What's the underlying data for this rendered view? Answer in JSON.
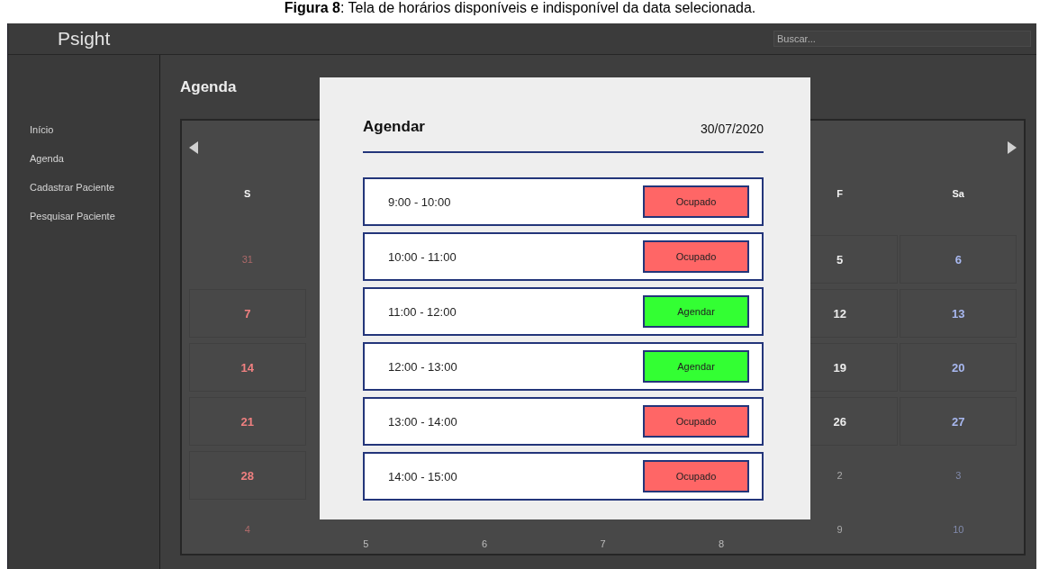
{
  "caption": "**Figura 8**: Tela de horários disponíveis e indisponível da data selecionada.",
  "header": {
    "logo": "Psight",
    "search": {
      "placeholder": "Buscar..."
    }
  },
  "sidebar": {
    "items": [
      {
        "label": "Início"
      },
      {
        "label": "Agenda"
      },
      {
        "label": "Cadastrar Paciente"
      },
      {
        "label": "Pesquisar Paciente"
      }
    ]
  },
  "page_title": "Agenda",
  "calendar": {
    "columns": [
      {
        "kind": "full",
        "weekday": "S",
        "color": "#f08080",
        "days": [
          {
            "day": "31",
            "in_month": false
          },
          {
            "day": "7",
            "in_month": true
          },
          {
            "day": "14",
            "in_month": true
          },
          {
            "day": "21",
            "in_month": true
          },
          {
            "day": "28",
            "in_month": true
          },
          {
            "day": "4",
            "in_month": false
          }
        ]
      },
      {
        "kind": "covered",
        "days": [
          {
            "day": "5"
          }
        ]
      },
      {
        "kind": "covered",
        "days": [
          {
            "day": "6"
          }
        ]
      },
      {
        "kind": "covered",
        "days": [
          {
            "day": "7"
          }
        ]
      },
      {
        "kind": "covered",
        "days": [
          {
            "day": "8"
          }
        ]
      },
      {
        "kind": "full",
        "weekday": "F",
        "color": "#ececec",
        "days": [
          {
            "day": "5",
            "in_month": true
          },
          {
            "day": "12",
            "in_month": true
          },
          {
            "day": "19",
            "in_month": true
          },
          {
            "day": "26",
            "in_month": true
          },
          {
            "day": "2",
            "in_month": false
          },
          {
            "day": "9",
            "in_month": false
          }
        ]
      },
      {
        "kind": "full",
        "weekday": "Sa",
        "color": "#a8b8f0",
        "days": [
          {
            "day": "6",
            "in_month": true
          },
          {
            "day": "13",
            "in_month": true
          },
          {
            "day": "20",
            "in_month": true
          },
          {
            "day": "27",
            "in_month": true
          },
          {
            "day": "3",
            "in_month": false
          },
          {
            "day": "10",
            "in_month": false
          }
        ]
      }
    ]
  },
  "modal": {
    "title": "Agendar",
    "date": "30/07/2020",
    "slots": [
      {
        "time": "9:00 - 10:00",
        "kind": "busy",
        "action": "Ocupado"
      },
      {
        "time": "10:00 - 11:00",
        "kind": "busy",
        "action": "Ocupado"
      },
      {
        "time": "11:00 - 12:00",
        "kind": "free",
        "action": "Agendar"
      },
      {
        "time": "12:00 - 13:00",
        "kind": "free",
        "action": "Agendar"
      },
      {
        "time": "13:00 - 14:00",
        "kind": "busy",
        "action": "Ocupado"
      },
      {
        "time": "14:00 - 15:00",
        "kind": "busy",
        "action": "Ocupado"
      }
    ]
  }
}
